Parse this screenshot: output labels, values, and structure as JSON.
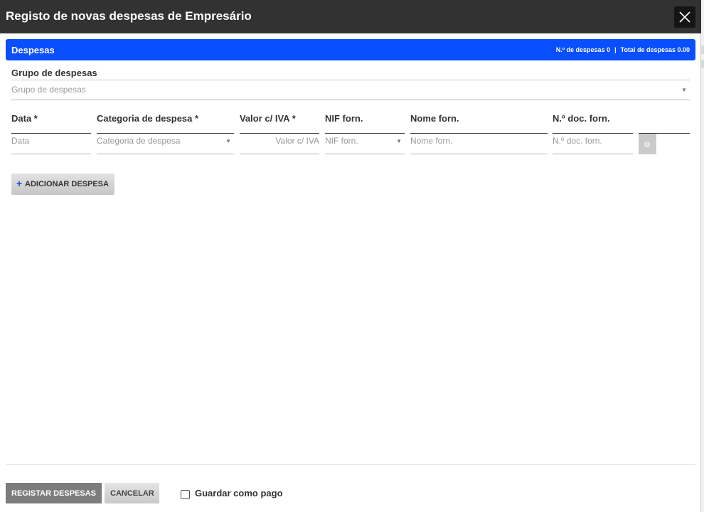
{
  "dialog": {
    "title": "Registo de novas despesas de Empresário"
  },
  "section": {
    "title": "Despesas",
    "count_label": "N.º de despesas 0",
    "separator": "|",
    "total_label": "Total de despesas 0.00"
  },
  "group": {
    "label": "Grupo de despesas",
    "placeholder": "Grupo de despesas"
  },
  "columns": {
    "data": {
      "label": "Data *",
      "placeholder": "Data"
    },
    "categoria": {
      "label": "Categoria de despesa *",
      "placeholder": "Categoria de despesa"
    },
    "valor": {
      "label": "Valor c/ IVA *",
      "placeholder": "Valor c/ IVA"
    },
    "nif": {
      "label": "NIF forn.",
      "placeholder": "NIF forn."
    },
    "nome": {
      "label": "Nome forn.",
      "placeholder": "Nome forn."
    },
    "doc": {
      "label": "N.º doc. forn.",
      "placeholder": "N.º doc. forn."
    }
  },
  "actions": {
    "add_expense": "ADICIONAR DESPESA",
    "register": "REGISTAR DESPESAS",
    "cancel": "CANCELAR",
    "mark_paid": "Guardar como pago"
  },
  "icons": {
    "close": "close-icon",
    "caret": "chevron-down-icon",
    "plus": "plus-icon",
    "info": "info-icon"
  },
  "colors": {
    "titlebar": "#323232",
    "section_accent": "#0a4fff",
    "primary_button": "#7c7c7c"
  }
}
